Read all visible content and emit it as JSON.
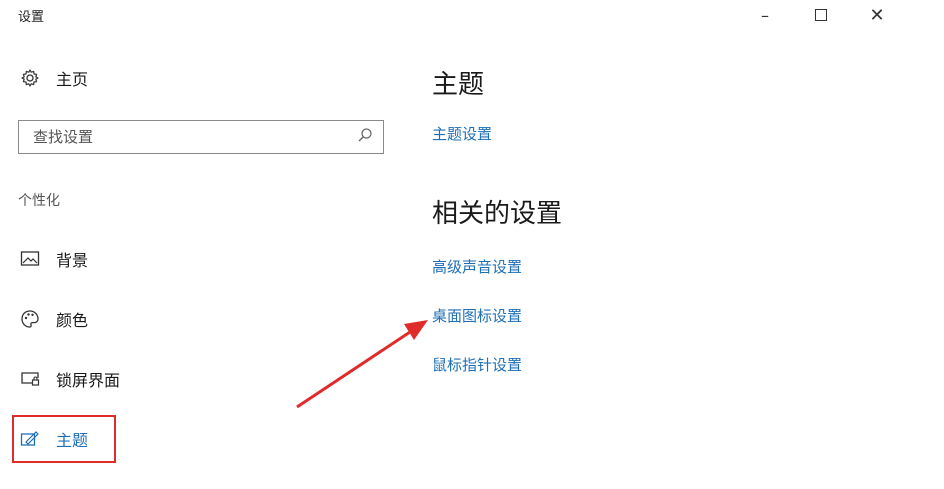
{
  "window": {
    "title": "设置",
    "minimize_glyph": "–",
    "close_glyph": "✕"
  },
  "sidebar": {
    "home_label": "主页",
    "search_placeholder": "查找设置",
    "section_label": "个性化",
    "items": [
      {
        "label": "背景",
        "icon": "picture-icon"
      },
      {
        "label": "颜色",
        "icon": "palette-icon"
      },
      {
        "label": "锁屏界面",
        "icon": "lock-screen-icon"
      },
      {
        "label": "主题",
        "icon": "theme-brush-icon",
        "selected": true
      }
    ]
  },
  "main": {
    "heading": "主题",
    "theme_settings_link": "主题设置",
    "related_heading": "相关的设置",
    "related_links": [
      "高级声音设置",
      "桌面图标设置",
      "鼠标指针设置"
    ]
  },
  "annotations": {
    "highlight_color": "#e02b2b",
    "arrow_color": "#e02b2b"
  },
  "colors": {
    "link": "#1f6fb5",
    "text": "#1a1a1a"
  }
}
